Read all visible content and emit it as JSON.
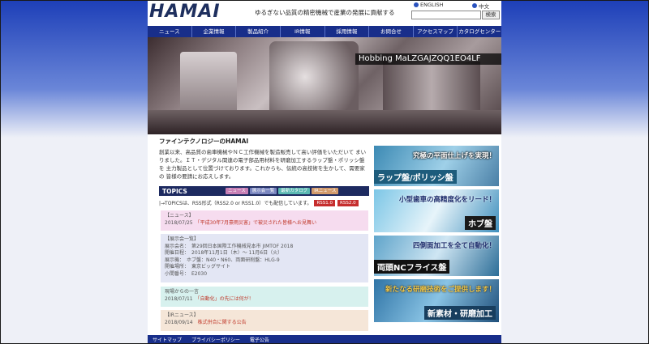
{
  "header": {
    "logo": "HAMAI",
    "tagline": "ゆるぎない品質の精密機械で産業の発展に貢献する",
    "lang_english": "ENGLISH",
    "lang_chinese": "中文",
    "search_button": "検索"
  },
  "nav": [
    "ニュース",
    "企業情報",
    "製品紹介",
    "IR情報",
    "採用情報",
    "お問合せ",
    "アクセスマップ",
    "カタログセンター"
  ],
  "hero": {
    "caption": "Hobbing MaLZGAJZQQ1EO4LF"
  },
  "intro": {
    "title": "ファインテクノロジーのHAMAI",
    "body": "創業以来、高品質の歯車機械やＮＣ工作機械を製造販売して高い評価をいただいて まいりました。ＩＴ・デジタル関連の電子部品用材料を研磨加工するラップ盤・ポリッシ盤を 主力製品として位置づけております。これからも、伝統の高技術を生かして、需要家の 皆様の要請にお応えします。"
  },
  "topics": {
    "title": "TOPICS",
    "buttons": [
      "ニュース",
      "展示会一覧",
      "最新カタログ",
      "IRニュース"
    ],
    "rss_text": "|→TOPICSは、RSS形式（RSS2.0 or RSS1.0）でも配信しています。",
    "rss1": "RSS1.0",
    "rss2": "RSS2.0"
  },
  "news": [
    {
      "cat": "【ニュース】",
      "date": "2018/07/25",
      "text": "「平成30年7月豪雨災害」で被災された皆様へお見舞い"
    },
    {
      "cat": "【展示会一覧】",
      "lines": [
        "展示会名：　第29回日本国際工作機械見本市 JIMTOF 2018",
        "開催日程：　2018年11月1日（木）～ 11月6日（火）",
        "展示機：　ホブ盤：N40・N60、両面研削盤：HLG-9",
        "開催場所：　東京ビッグサイト",
        "小間番号：　E2030"
      ]
    },
    {
      "cat": "現場からの一言",
      "date": "2018/07/11",
      "text": "「自動化」の先には何が！"
    },
    {
      "cat": "【IRニュース】",
      "date": "2018/09/14",
      "text": "株式併合に関する公告"
    }
  ],
  "side": [
    {
      "line1": "究極の平面仕上げを実現！",
      "line2": "ラップ盤/ポリッシ盤"
    },
    {
      "line1": "小型歯車の高精度化をリード！",
      "line2": "ホブ盤"
    },
    {
      "line1": "四側面加工を全て自動化！",
      "line2": "両頭NCフライス盤"
    },
    {
      "line1": "新たなる研磨技術をご提供します！",
      "line2": "新素材・研磨加工"
    }
  ],
  "footer": [
    "サイトマップ",
    "プライバシーポリシー",
    "電子公告"
  ],
  "colors": {
    "nav": "#182e8a",
    "topics": "#1d2a60",
    "rss": "#c62e2e"
  }
}
